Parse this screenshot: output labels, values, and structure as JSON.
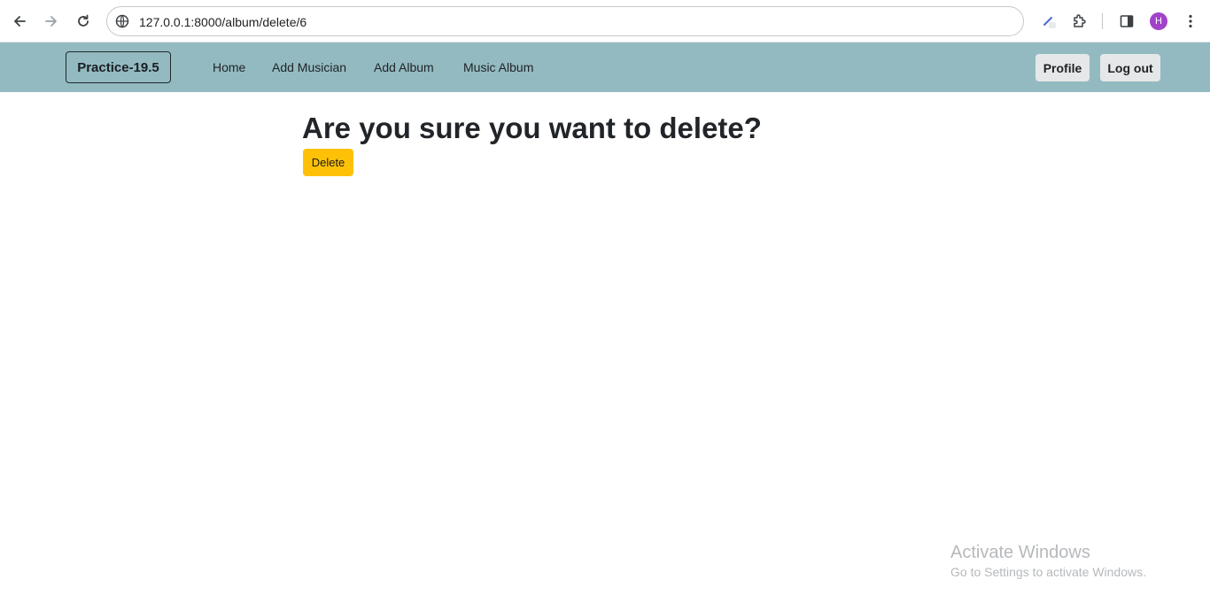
{
  "browser": {
    "url": "127.0.0.1:8000/album/delete/6",
    "profile_initial": "H",
    "icons": [
      "back-icon",
      "forward-icon",
      "reload-icon",
      "site-info-icon",
      "edit-extension-icon",
      "extensions-icon",
      "side-panel-icon",
      "more-options-icon"
    ]
  },
  "navbar": {
    "brand": "Practice-19.5",
    "links": [
      {
        "label": "Home"
      },
      {
        "label": "Add Musician"
      },
      {
        "label": "Add Album"
      },
      {
        "label": "Music Album"
      }
    ],
    "profile_label": "Profile",
    "logout_label": "Log out",
    "background_color": "#93bac1"
  },
  "main": {
    "heading": "Are you sure you want to delete?",
    "delete_label": "Delete",
    "delete_color": "#ffc107"
  },
  "watermark": {
    "title": "Activate Windows",
    "subtitle": "Go to Settings to activate Windows."
  }
}
